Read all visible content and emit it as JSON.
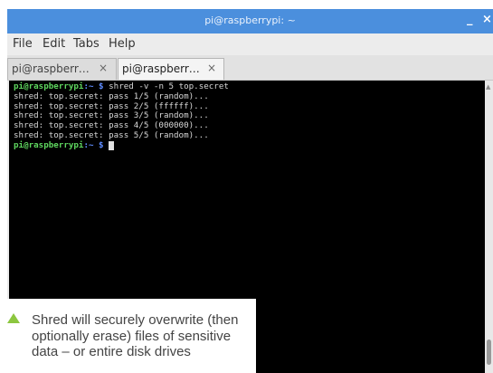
{
  "window": {
    "title": "pi@raspberrypi: ~",
    "minimize_glyph": "_",
    "close_glyph": "×"
  },
  "menu": [
    "File",
    "Edit",
    "Tabs",
    "Help"
  ],
  "tabs": [
    {
      "label": "pi@raspberr…",
      "close": "×",
      "active": false
    },
    {
      "label": "pi@raspberr…",
      "close": "×",
      "active": true
    }
  ],
  "terminal": {
    "command_prompt": "pi@raspberrypi",
    "command_dir": ":~ $",
    "command": " shred -v -n 5 top.secret",
    "output": [
      "shred: top.secret: pass 1/5 (random)...",
      "shred: top.secret: pass 2/5 (ffffff)...",
      "shred: top.secret: pass 3/5 (random)...",
      "shred: top.secret: pass 4/5 (000000)...",
      "shred: top.secret: pass 5/5 (random)..."
    ],
    "final_prompt": "pi@raspberrypi",
    "final_dir": ":~ $"
  },
  "caption": {
    "text": "Shred will securely overwrite (then optionally erase) files of sensitive data – or entire disk drives"
  },
  "colors": {
    "titlebar": "#4b8fdd",
    "prompt": "#5fd75f",
    "caption_arrow": "#8cc63f"
  },
  "icons": {
    "arrow": "triangle-up-icon"
  }
}
